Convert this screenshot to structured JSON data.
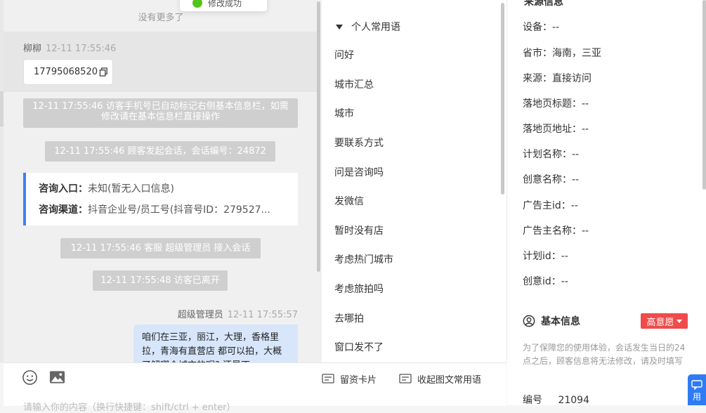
{
  "toast": {
    "text": "修改成功"
  },
  "chat": {
    "no_more": "没有更多了",
    "visitor": {
      "name": "柳柳",
      "time": "12-11 17:55:46",
      "phone": "17795068520"
    },
    "system_messages": [
      "12-11 17:55:46 访客手机号已自动标记右侧基本信息栏，如需修改请在基本信息栏直接操作",
      "12-11 17:55:46 顾客发起会话，会话编号：24872",
      "12-11 17:55:46 客服 超级管理员 接入会话",
      "12-11 17:55:48 访客已离开"
    ],
    "entry_card": {
      "entry_label": "咨询入口：",
      "entry_value": "未知(暂无入口信息)",
      "channel_label": "咨询渠道：",
      "channel_value": "抖音企业号/员工号(抖音号ID：279527..."
    },
    "agent": {
      "name": "超级管理员",
      "time": "12-11 17:55:57",
      "message": "咱们在三亚，丽江，大理，香格里拉，青海有直营店 都可以拍，大概了解哪个城市的呢? 还是不"
    }
  },
  "input": {
    "emoji_icon": "smiley-icon",
    "image_icon": "image-icon",
    "card_button": "留资卡片",
    "collapse_button": "收起图文常用语",
    "placeholder": "请输入你的内容（换行快捷键：shift/ctrl + enter）"
  },
  "phrases": {
    "group_title": "个人常用语",
    "items": [
      "问好",
      "城市汇总",
      "城市",
      "要联系方式",
      "问是咨询吗",
      "发微信",
      "暂时没有店",
      "考虑热门城市",
      "考虑旅拍吗",
      "去哪拍",
      "窗口发不了"
    ]
  },
  "info": {
    "source_title": "来源信息",
    "source_rows": [
      "设备：--",
      "省市：海南，三亚",
      "来源：直接访问",
      "落地页标题：--",
      "落地页地址：--",
      "计划名称：--",
      "创意名称：--",
      "广告主id：--",
      "广告主名称：--",
      "计划id：--",
      "创意id：--"
    ],
    "basic_title": "基本信息",
    "intent_badge": "高意愿",
    "hint": "为了保障您的使用体验，会话发生当日的24点之后，顾客信息将无法修改，请及时填写",
    "id_label": "编号",
    "id_value": "21094",
    "float_label": "用"
  },
  "colors": {
    "accent": "#3b82f6",
    "badge": "#f04b4b",
    "agent_bubble": "#d7e6fb"
  }
}
